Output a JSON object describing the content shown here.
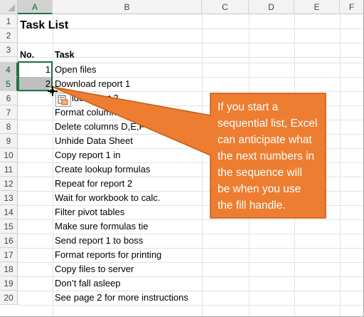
{
  "columns": [
    "A",
    "B",
    "C",
    "D",
    "E",
    "F"
  ],
  "rows": [
    "1",
    "2",
    "3",
    "4",
    "5",
    "6",
    "7",
    "8",
    "9",
    "10",
    "11",
    "12",
    "13",
    "14",
    "15",
    "16",
    "17",
    "18",
    "19",
    "20"
  ],
  "cells": {
    "title": "Task List",
    "no_header": "No.",
    "task_header": "Task",
    "num_4": "1",
    "num_5": "2"
  },
  "tasks": [
    "Open files",
    "Download report 1",
    "Unhide report 2",
    "Format column A",
    "Delete columns D,E,F",
    "Unhide Data Sheet",
    "Copy report 1 in",
    "Create lookup formulas",
    "Repeat for report 2",
    "Wait for workbook to calc.",
    "Filter pivot tables",
    "Make sure formulas tie",
    "Send report 1 to boss",
    "Format reports for printing",
    "Copy files to server",
    "Don’t fall asleep",
    "See page 2 for more instructions"
  ],
  "callout": {
    "lines": [
      "If you start a",
      "sequential list, Excel",
      "can anticipate what",
      "the next numbers in",
      "the sequence will",
      "be when you use",
      "the fill handle."
    ],
    "color": "#ed7d31",
    "border_color": "#c55a11"
  },
  "selection_color": "#217346"
}
